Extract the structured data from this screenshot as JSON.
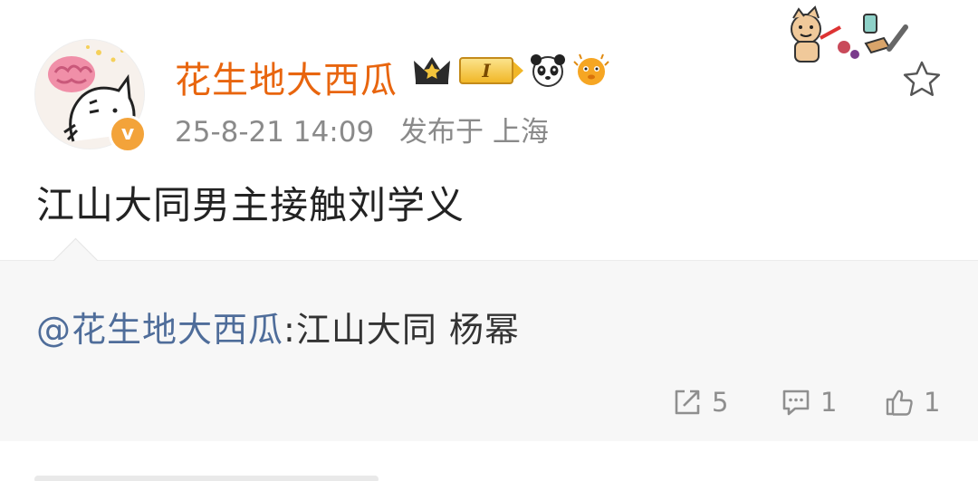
{
  "post": {
    "username": "花生地大西瓜",
    "time": "25-8-21 14:09",
    "location": "发布于 上海",
    "level_badge": "I",
    "text": "江山大同男主接触刘学义"
  },
  "repost": {
    "mention": "@花生地大西瓜",
    "content": ":江山大同 杨幂"
  },
  "actions": {
    "repost_count": "5",
    "comment_count": "1",
    "like_count": "1"
  },
  "icons": {
    "verified": "verified-badge-icon",
    "star": "star-icon",
    "repost": "repost-icon",
    "comment": "comment-icon",
    "like": "thumbs-up-icon"
  },
  "colors": {
    "username": "#e8650e",
    "mention": "#4f6d9a",
    "meta": "#8a8a8a",
    "verified": "#f3a33a"
  }
}
